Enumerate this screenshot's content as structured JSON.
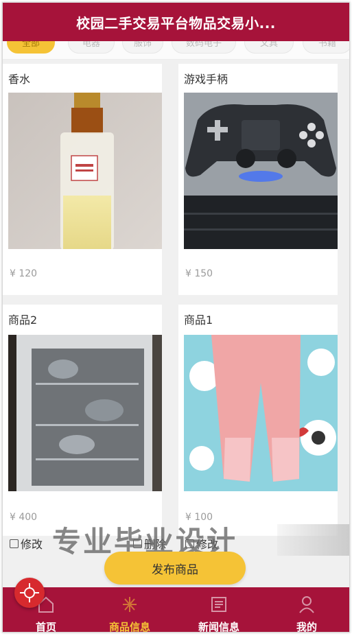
{
  "header": {
    "title": "校园二手交易平台物品交易小..."
  },
  "categories": [
    {
      "label": "全部",
      "active": true
    },
    {
      "label": "电器",
      "active": false
    },
    {
      "label": "服饰",
      "active": false
    },
    {
      "label": "数码电子",
      "active": false
    },
    {
      "label": "文具",
      "active": false
    },
    {
      "label": "书籍",
      "active": false
    }
  ],
  "products": [
    {
      "name": "香水",
      "price": "¥ 120"
    },
    {
      "name": "游戏手柄",
      "price": "¥ 150"
    },
    {
      "name": "商品2",
      "price": "¥ 400"
    },
    {
      "name": "商品1",
      "price": "¥ 100"
    }
  ],
  "actions": {
    "edit_label": "修改",
    "delete_label": "删除",
    "publish_label": "发布商品"
  },
  "watermark": "专业毕业设计",
  "tabbar": [
    {
      "label": "首页",
      "icon": "home-icon",
      "active": false
    },
    {
      "label": "商品信息",
      "icon": "goods-icon",
      "active": true
    },
    {
      "label": "新闻信息",
      "icon": "news-icon",
      "active": false
    },
    {
      "label": "我的",
      "icon": "user-icon",
      "active": false
    }
  ],
  "colors": {
    "primary": "#a6133a",
    "accent": "#f5c336",
    "fab": "#d72a2e"
  }
}
